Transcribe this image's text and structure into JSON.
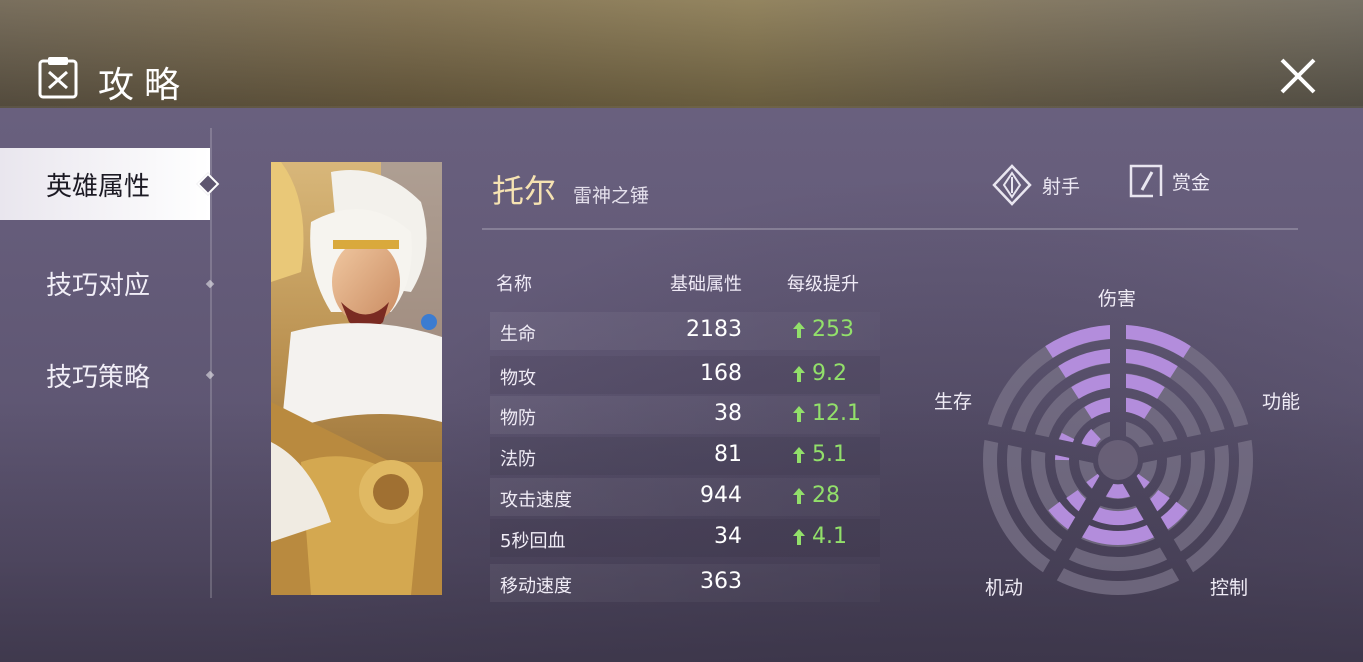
{
  "header": {
    "title": "攻略",
    "title_icon": "guide-book-icon",
    "close_icon": "close-icon"
  },
  "sidebar": {
    "items": [
      {
        "label": "英雄属性",
        "active": true
      },
      {
        "label": "技巧对应",
        "active": false
      },
      {
        "label": "技巧策略",
        "active": false
      }
    ]
  },
  "hero": {
    "name": "托尔",
    "subtitle": "雷神之锤",
    "roles": [
      {
        "label": "射手",
        "icon": "marksman-icon"
      },
      {
        "label": "赏金",
        "icon": "bounty-icon"
      }
    ]
  },
  "stats": {
    "headers": {
      "name": "名称",
      "base": "基础属性",
      "growth": "每级提升"
    },
    "rows": [
      {
        "name": "生命",
        "base": "2183",
        "growth": "253"
      },
      {
        "name": "物攻",
        "base": "168",
        "growth": "9.2"
      },
      {
        "name": "物防",
        "base": "38",
        "growth": "12.1"
      },
      {
        "name": "法防",
        "base": "81",
        "growth": "5.1"
      },
      {
        "name": "攻击速度",
        "base": "944",
        "growth": "28"
      },
      {
        "name": "5秒回血",
        "base": "34",
        "growth": "4.1"
      },
      {
        "name": "移动速度",
        "base": "363",
        "growth": ""
      }
    ]
  },
  "radar": {
    "labels": {
      "top": "伤害",
      "left": "生存",
      "right": "功能",
      "bottom_left": "机动",
      "bottom_right": "控制"
    },
    "accent": "#b38ddc"
  },
  "colors": {
    "growth_green": "#92e06a",
    "hero_name_gold": "#f6e3b2"
  }
}
